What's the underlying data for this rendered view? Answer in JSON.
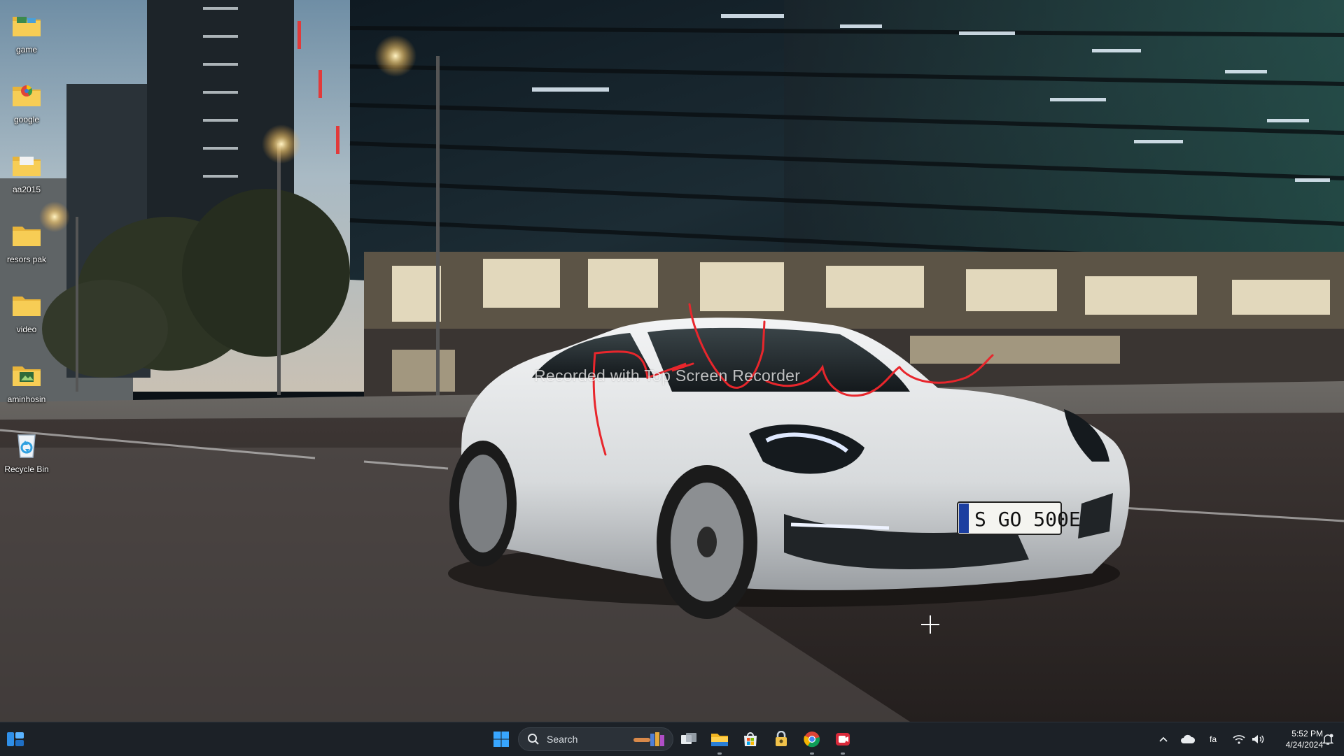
{
  "desktop": {
    "icons": [
      {
        "label": "game",
        "icon": "folder-icon"
      },
      {
        "label": "google",
        "icon": "folder-icon"
      },
      {
        "label": "aa2015",
        "icon": "folder-icon"
      },
      {
        "label": "resors pak",
        "icon": "folder-icon"
      },
      {
        "label": "video",
        "icon": "folder-icon"
      },
      {
        "label": "aminhosin",
        "icon": "folder-icon"
      },
      {
        "label": "Recycle Bin",
        "icon": "recycle-bin-icon"
      }
    ]
  },
  "wallpaper": {
    "license_plate": "S GO 500E"
  },
  "watermark": {
    "text": "Recorded with Top Screen Recorder"
  },
  "taskbar": {
    "search_placeholder": "Search",
    "pinned": [
      "windows-start-icon",
      "task-view-icon",
      "file-explorer-icon",
      "microsoft-store-icon",
      "app-icon",
      "chrome-icon",
      "screen-recorder-icon"
    ],
    "tray": {
      "language": "fa",
      "time": "5:52 PM",
      "date": "4/24/2024"
    }
  },
  "colors": {
    "taskbar_bg": "#1c2127",
    "annotation_red": "#e8262c",
    "windows_blue": "#1e90ff"
  }
}
